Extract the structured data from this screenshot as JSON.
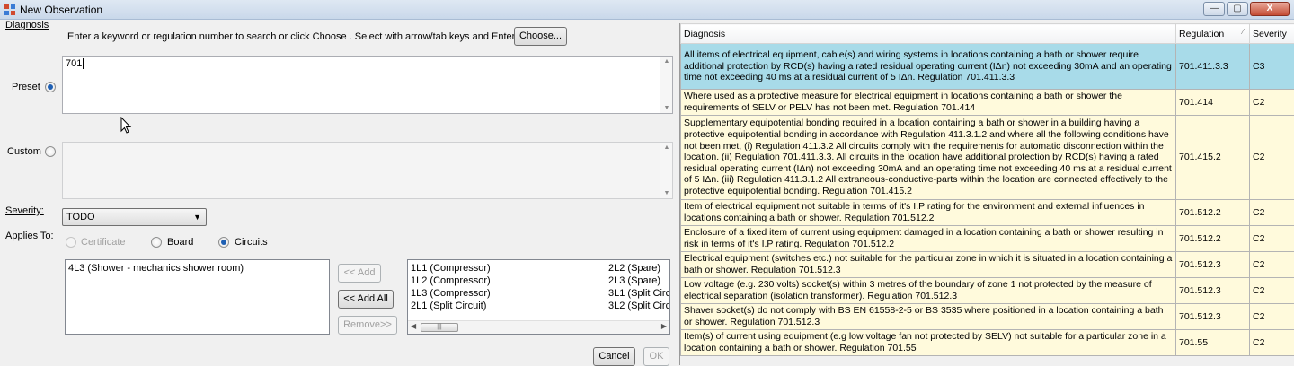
{
  "window": {
    "title": "New Observation",
    "min_label": "—",
    "max_label": "▢",
    "close_label": "X"
  },
  "form": {
    "diagnosis_label": "Diagnosis",
    "instructions": "Enter a keyword or regulation number to search or click Choose . Select with arrow/tab keys and Enter.",
    "choose_button": "Choose...",
    "preset_label": "Preset",
    "preset_value": "701",
    "custom_label": "Custom",
    "custom_value": "",
    "severity_label": "Severity:",
    "severity_value": "TODO",
    "applies_to_label": "Applies To:",
    "applies_options": {
      "certificate": "Certificate",
      "board": "Board",
      "circuits": "Circuits"
    },
    "selected_circuits": [
      "4L3 (Shower - mechanics shower room)"
    ],
    "add_button": "<< Add",
    "add_all_button": "<< Add All",
    "remove_button": "Remove>>",
    "available_circuits_col1": [
      "1L1 (Compressor)",
      "1L2 (Compressor)",
      "1L3 (Compressor)",
      "2L1 (Split Circuit)"
    ],
    "available_circuits_col2": [
      "2L2 (Spare)",
      "2L3 (Spare)",
      "3L1 (Split Circu",
      "3L2 (Split Circu"
    ],
    "cancel_button": "Cancel",
    "ok_button": "OK"
  },
  "grid": {
    "headers": {
      "diagnosis": "Diagnosis",
      "regulation": "Regulation",
      "severity": "Severity"
    },
    "rows": [
      {
        "diagnosis": "All items of electrical equipment, cable(s) and wiring systems in locations containing a bath or shower require additional protection by RCD(s) having a rated residual operating current (IΔn) not exceeding 30mA and an operating time not exceeding 40 ms at a residual current of 5 IΔn. Regulation 701.411.3.3",
        "regulation": "701.411.3.3",
        "severity": "C3",
        "selected": true
      },
      {
        "diagnosis": "Where used as a protective measure for electrical equipment in locations containing a bath or shower the requirements of SELV or PELV has not been met.  Regulation 701.414",
        "regulation": "701.414",
        "severity": "C2",
        "selected": false
      },
      {
        "diagnosis": "Supplementary equipotential bonding required in a location containing a bath or shower in a building having a protective equipotential bonding in accordance with Regulation 411.3.1.2 and where all the following conditions have not been met, (i) Regulation 411.3.2 All circuits comply with the requirements for automatic disconnection within the location. (ii) Regulation 701.411.3.3. All circuits in the location have additional protection by RCD(s) having a rated residual operating current (IΔn) not exceeding 30mA and an operating time not exceeding 40 ms at a residual current of 5 IΔn. (iii) Regulation 411.3.1.2 All extraneous-conductive-parts within the location are connected effectively to the protective equipotential bonding. Regulation 701.415.2",
        "regulation": "701.415.2",
        "severity": "C2",
        "selected": false
      },
      {
        "diagnosis": "Item of electrical equipment not suitable in terms of it's I.P rating for the environment and external influences in locations containing a bath or shower. Regulation 701.512.2",
        "regulation": "701.512.2",
        "severity": "C2",
        "selected": false
      },
      {
        "diagnosis": "Enclosure of a fixed item of current using equipment damaged in a location containing a bath or shower resulting in risk in terms of it's I.P rating. Regulation 701.512.2",
        "regulation": "701.512.2",
        "severity": "C2",
        "selected": false
      },
      {
        "diagnosis": "Electrical equipment (switches etc.) not suitable for the particular zone in which it is situated in a location containing a bath or shower. Regulation 701.512.3",
        "regulation": "701.512.3",
        "severity": "C2",
        "selected": false
      },
      {
        "diagnosis": "Low voltage (e.g. 230 volts) socket(s) within 3 metres of the boundary of zone 1 not protected by the measure of electrical separation (isolation transformer). Regulation 701.512.3",
        "regulation": "701.512.3",
        "severity": "C2",
        "selected": false
      },
      {
        "diagnosis": "Shaver socket(s) do not comply with BS EN 61558-2-5 or BS 3535 where positioned in a location containing a bath or shower. Regulation 701.512.3",
        "regulation": "701.512.3",
        "severity": "C2",
        "selected": false
      },
      {
        "diagnosis": "Item(s) of current using equipment (e.g low voltage fan not protected by SELV) not suitable for a particular zone in a location containing a bath or shower. Regulation 701.55",
        "regulation": "701.55",
        "severity": "C2",
        "selected": false
      }
    ]
  }
}
